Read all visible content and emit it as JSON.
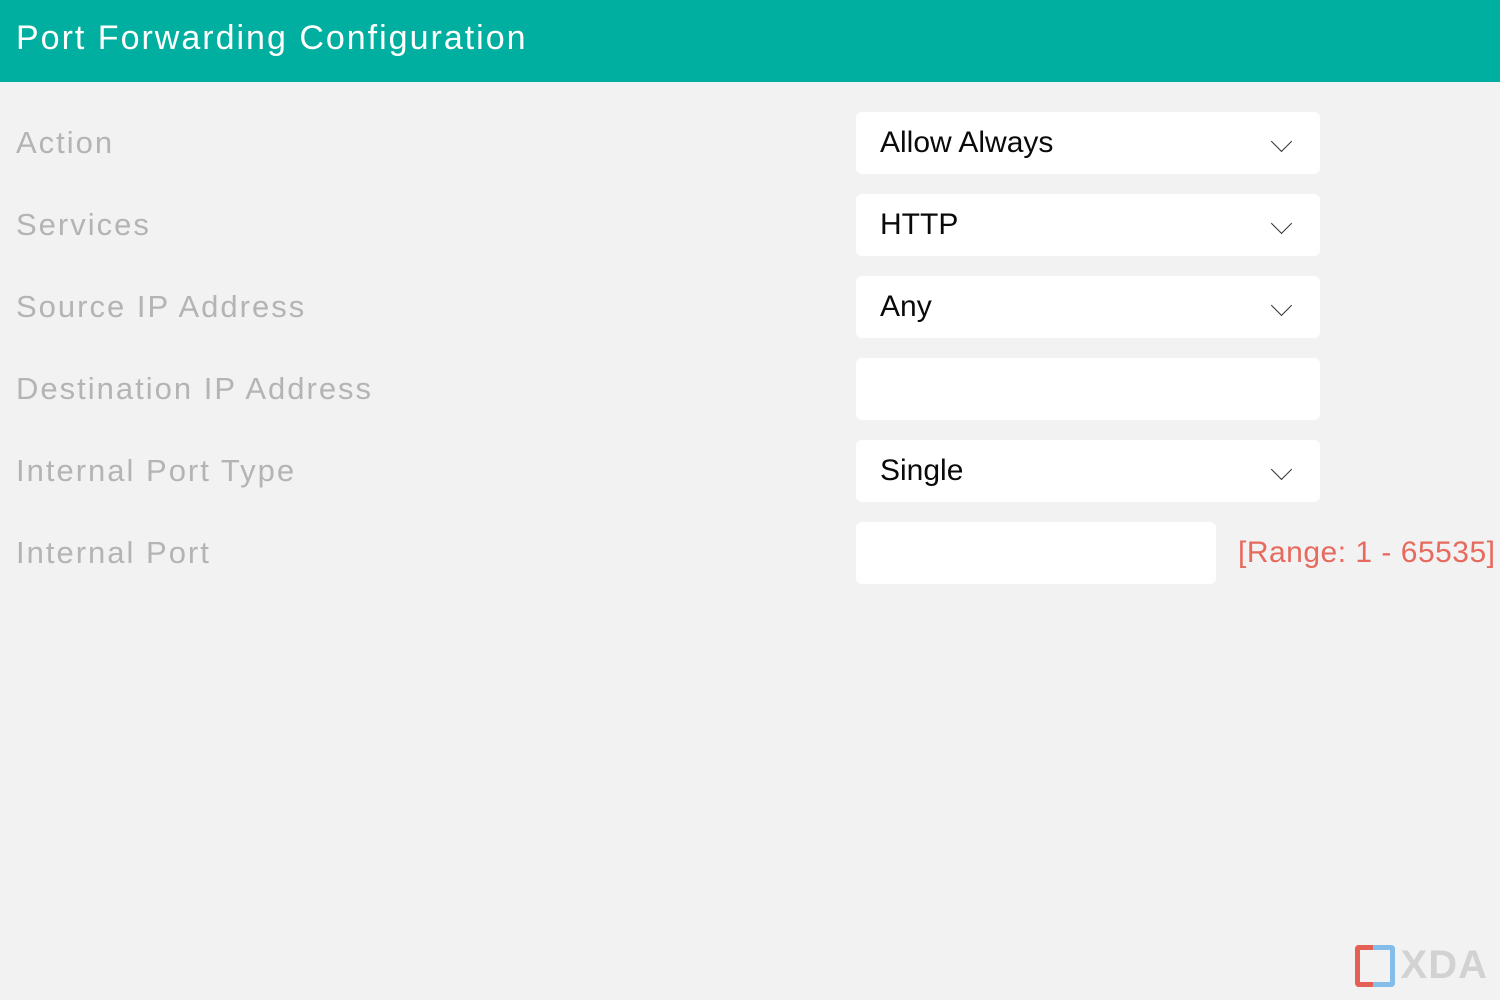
{
  "header": {
    "title": "Port Forwarding Configuration"
  },
  "form": {
    "action": {
      "label": "Action",
      "value": "Allow Always"
    },
    "services": {
      "label": "Services",
      "value": "HTTP"
    },
    "source_ip": {
      "label": "Source IP Address",
      "value": "Any"
    },
    "dest_ip": {
      "label": "Destination IP Address",
      "value": ""
    },
    "internal_port_type": {
      "label": "Internal Port Type",
      "value": "Single"
    },
    "internal_port": {
      "label": "Internal Port",
      "value": "",
      "range_hint": "[Range: 1 - 65535]"
    }
  },
  "watermark": {
    "text": "XDA"
  }
}
